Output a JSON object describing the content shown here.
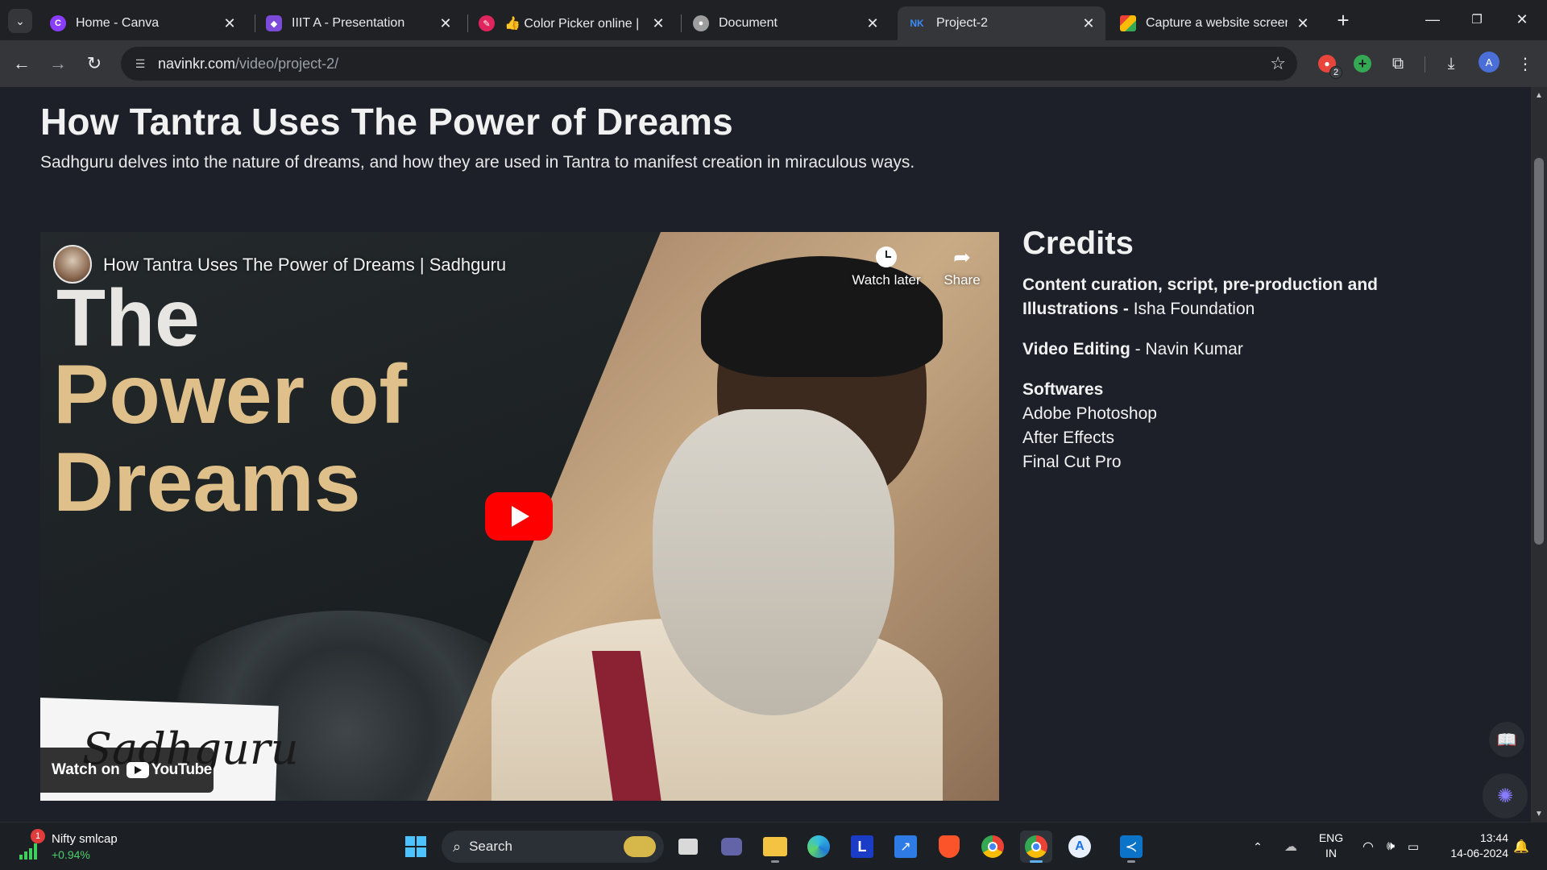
{
  "browser": {
    "tabs": [
      {
        "title": "Home - Canva",
        "favicon_color": "#8b3dff",
        "active": false
      },
      {
        "title": "IIIT A - Presentation",
        "favicon_color": "#7b4ad8",
        "active": false
      },
      {
        "title": "👍 Color Picker online | HE",
        "favicon_color": "#e0245e",
        "active": false
      },
      {
        "title": "Document",
        "favicon_color": "#9e9e9e",
        "active": false
      },
      {
        "title": "Project-2",
        "favicon_color": "#3b8cf6",
        "active": true
      },
      {
        "title": "Capture a website screensh",
        "favicon_color": "#f4b400",
        "active": false
      }
    ],
    "url_domain": "navinkr.com",
    "url_path": "/video/project-2/",
    "extension_badge": "2",
    "profile_initial": "A"
  },
  "page": {
    "title": "How Tantra Uses The Power of Dreams",
    "subtitle": "Sadhguru delves into the nature of dreams, and how they are used in Tantra to manifest creation in miraculous ways."
  },
  "video": {
    "title": "How Tantra Uses The Power of Dreams | Sadhguru",
    "watch_later_label": "Watch later",
    "share_label": "Share",
    "watch_on_label": "Watch on",
    "youtube_label": "YouTube",
    "thumbnail_line1": "The",
    "thumbnail_line2": "Power of",
    "thumbnail_line3": "Dreams",
    "signature_text": "Sadhguru",
    "play_color": "#ff0000"
  },
  "credits": {
    "heading": "Credits",
    "content_label": "Content curation, script, pre-production and Illustrations -",
    "content_value": "Isha Foundation",
    "editing_label": "Video Editing",
    "editing_value": "- Navin Kumar",
    "softwares_label": "Softwares",
    "softwares": [
      "Adobe Photoshop",
      "After Effects",
      "Final Cut Pro"
    ]
  },
  "taskbar": {
    "widget_name": "Nifty smlcap",
    "widget_change": "+0.94%",
    "widget_badge": "1",
    "search_label": "Search",
    "lang_line1": "ENG",
    "lang_line2": "IN",
    "time": "13:44",
    "date": "14-06-2024"
  }
}
